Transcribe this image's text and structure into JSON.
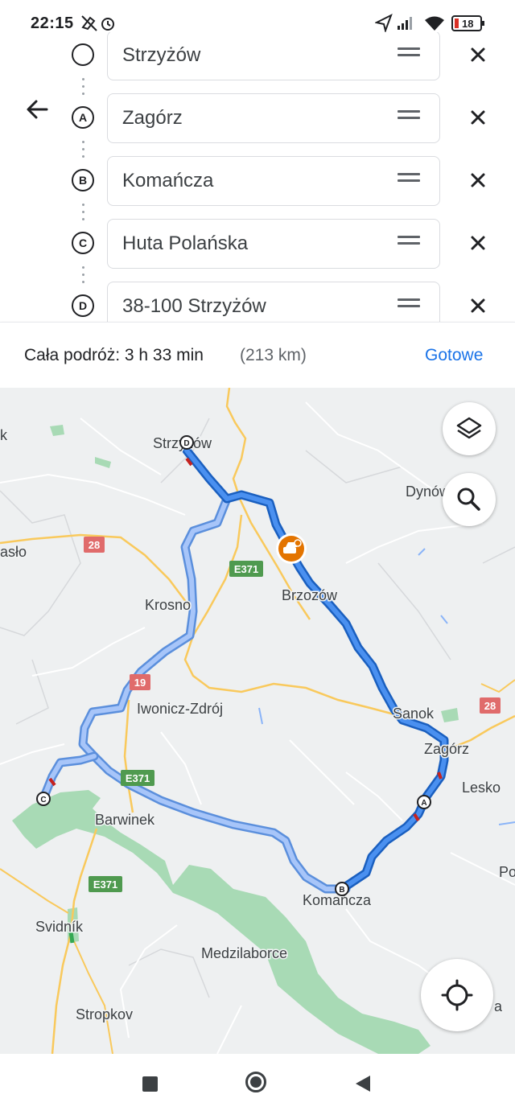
{
  "status_bar": {
    "time": "22:15",
    "battery": "18"
  },
  "stops": [
    {
      "marker": "",
      "label": "Strzyżów"
    },
    {
      "marker": "A",
      "label": "Zagórz"
    },
    {
      "marker": "B",
      "label": "Komańcza"
    },
    {
      "marker": "C",
      "label": "Huta Polańska"
    },
    {
      "marker": "D",
      "label": "38-100 Strzyżów"
    }
  ],
  "summary": {
    "trip_label": "Cała podróż: 3 h 33 min",
    "distance": "(213 km)",
    "done_label": "Gotowe"
  },
  "map": {
    "place_labels": [
      "Strzyżów",
      "Dynów",
      "asło",
      "Krosno",
      "Brzozów",
      "Iwonicz-Zdrój",
      "Sanok",
      "Zagórz",
      "Lesko",
      "Barwinek",
      "Po",
      "Komańcza",
      "Svidník",
      "Medzilaborce",
      "Stropkov",
      "a",
      "k"
    ],
    "road_shields": [
      "28",
      "E371",
      "19",
      "28",
      "E371",
      "E371"
    ],
    "waypoint_markers": [
      "D",
      "A",
      "B",
      "C"
    ],
    "colors": {
      "route": "#1a73e8",
      "route_alt": "#a7c5f9",
      "park": "#a8dab5",
      "road_major": "#f9c95c",
      "incident": "#e37400"
    }
  },
  "icons": [
    "back-arrow-icon",
    "drag-handle-icon",
    "close-icon",
    "layers-icon",
    "search-icon",
    "my-location-icon",
    "traffic-incident-icon"
  ]
}
